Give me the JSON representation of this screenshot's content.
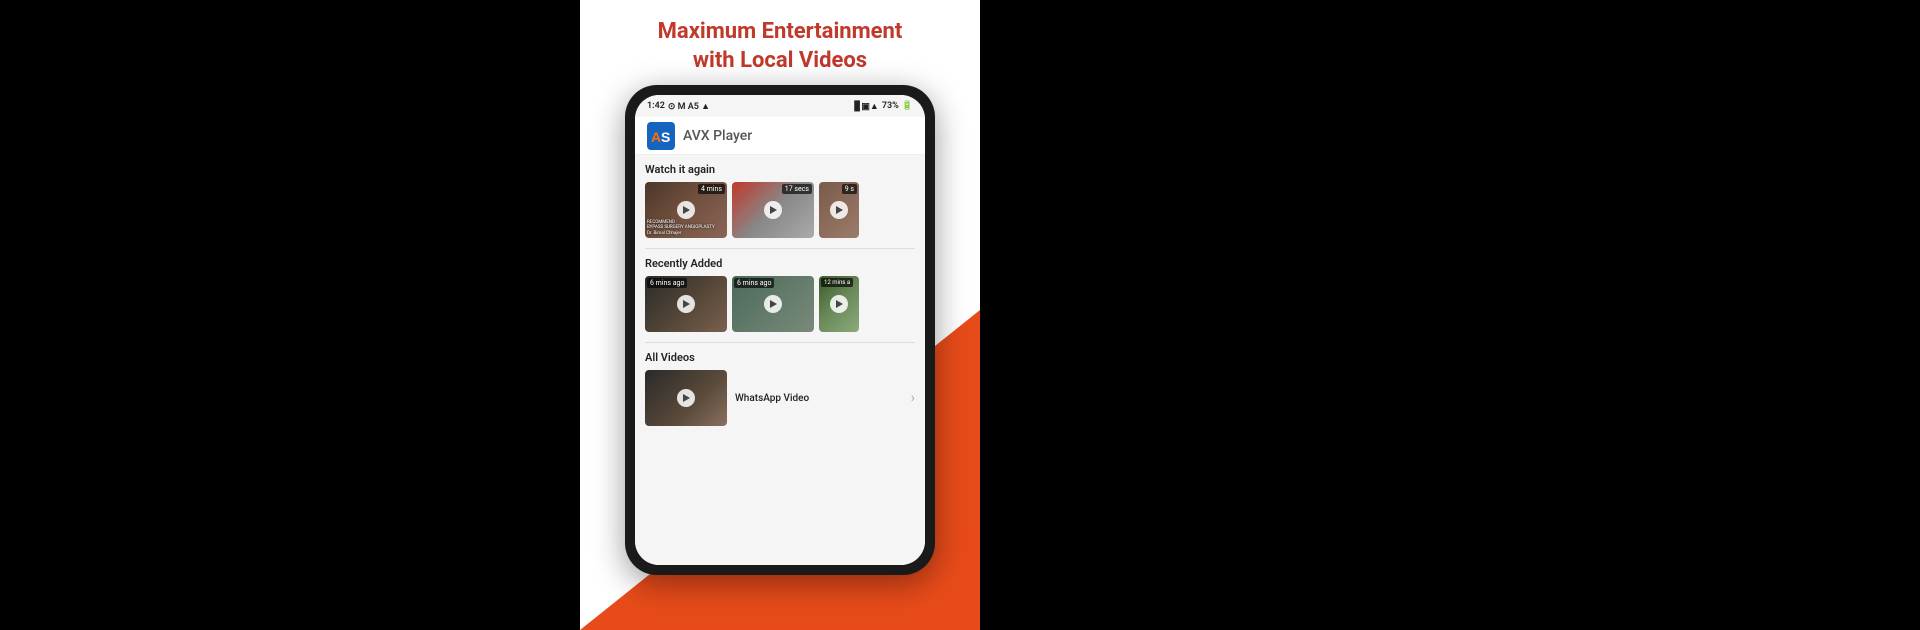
{
  "headline": {
    "line1": "Maximum Entertainment",
    "line2": "with Local Videos"
  },
  "status_bar": {
    "time": "1:42",
    "battery": "73%",
    "icons": "status-icons"
  },
  "app": {
    "name": "AVX Player"
  },
  "sections": {
    "watch_again": {
      "title": "Watch it again",
      "videos": [
        {
          "id": 1,
          "duration": "4 mins",
          "thumb_class": "thumb-1"
        },
        {
          "id": 2,
          "duration": "17 secs",
          "thumb_class": "thumb-2"
        },
        {
          "id": 3,
          "duration": "9 s",
          "thumb_class": "thumb-3",
          "partial": true
        }
      ]
    },
    "recently_added": {
      "title": "Recently Added",
      "videos": [
        {
          "id": 4,
          "time_ago": "6 mins ago",
          "thumb_class": "thumb-4"
        },
        {
          "id": 5,
          "time_ago": "6 mins ago",
          "thumb_class": "thumb-5"
        },
        {
          "id": 6,
          "time_ago": "12 mins a",
          "thumb_class": "thumb-6",
          "partial": true
        }
      ]
    },
    "all_videos": {
      "title": "All Videos",
      "items": [
        {
          "id": 7,
          "name": "WhatsApp Video",
          "thumb_class": "thumb-7"
        }
      ]
    }
  }
}
